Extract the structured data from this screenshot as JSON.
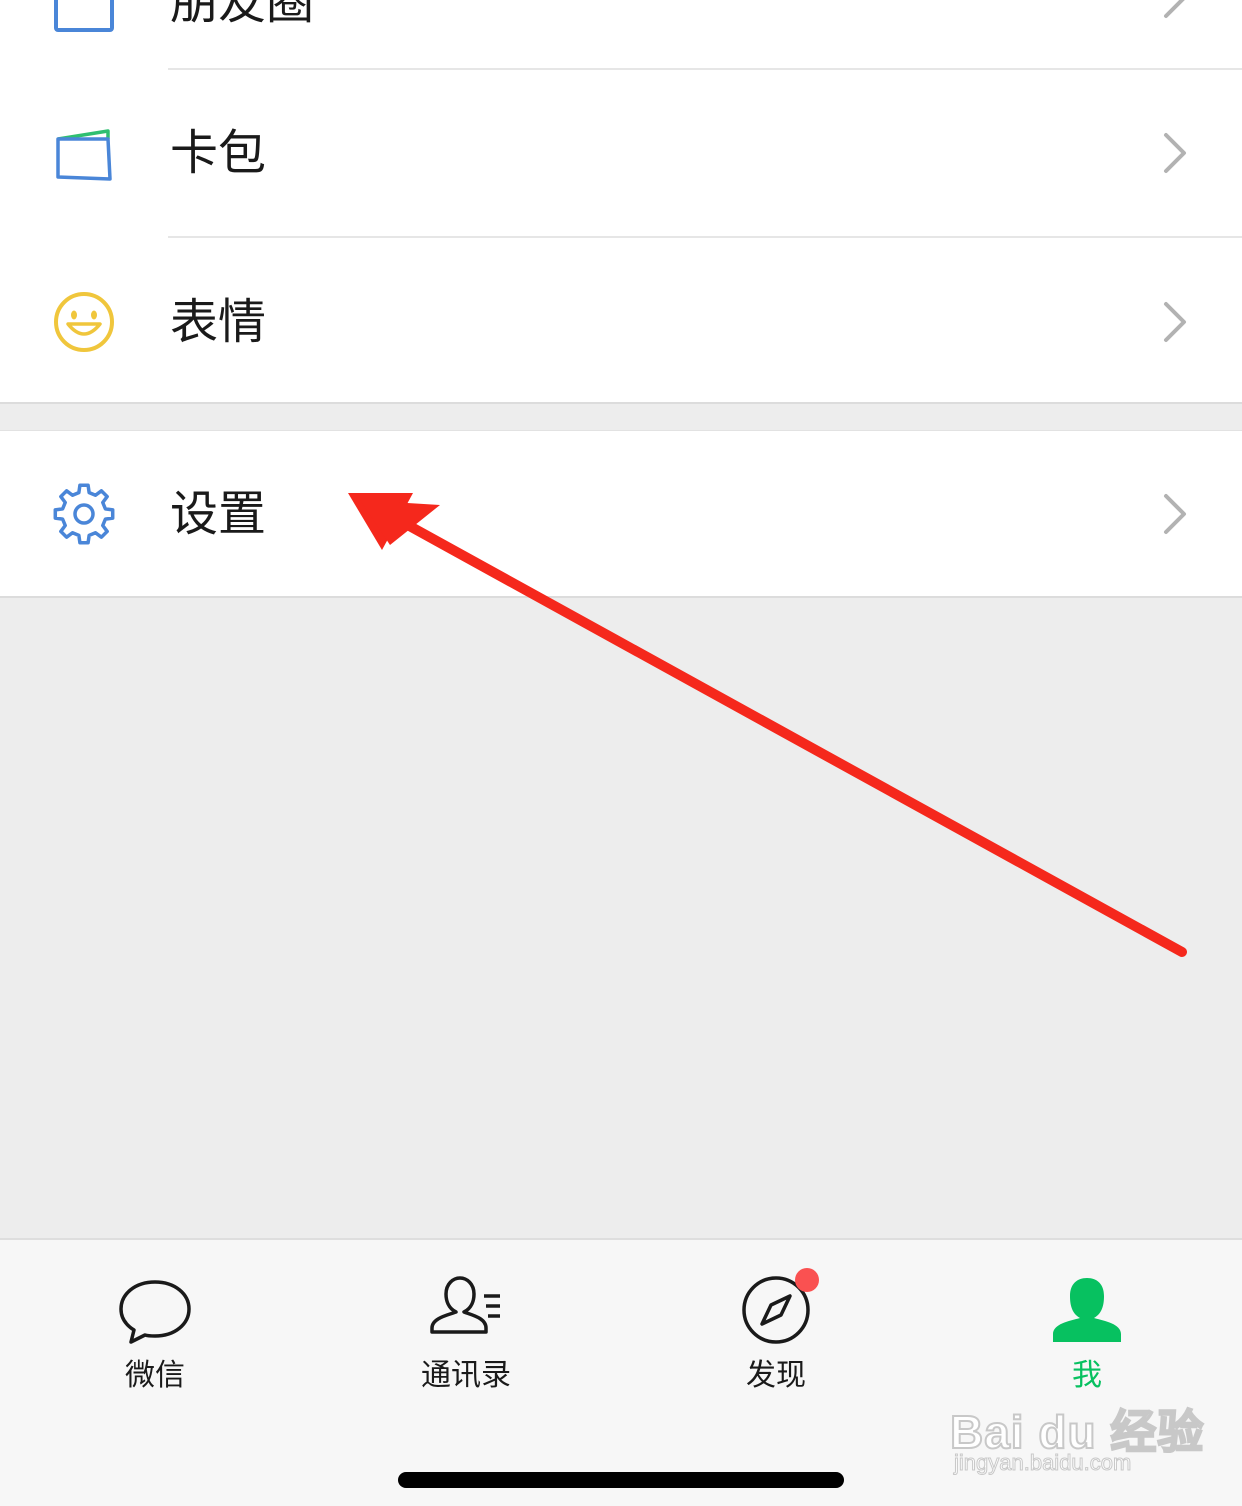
{
  "menu": {
    "partial_item_label": "朋友圈",
    "items": [
      {
        "label": "卡包",
        "icon": "card-wallet-icon"
      },
      {
        "label": "表情",
        "icon": "smiley-face-icon"
      }
    ],
    "settings": {
      "label": "设置",
      "icon": "gear-icon"
    }
  },
  "tabbar": {
    "tabs": [
      {
        "label": "微信",
        "icon": "chat-bubble-icon",
        "active": false
      },
      {
        "label": "通讯录",
        "icon": "contacts-icon",
        "active": false
      },
      {
        "label": "发现",
        "icon": "compass-icon",
        "active": false,
        "badge": true
      },
      {
        "label": "我",
        "icon": "person-icon",
        "active": true
      }
    ]
  },
  "annotation": {
    "arrow_color": "#f5281c",
    "points_to": "设置"
  },
  "watermark": {
    "brand": "Bai du 经验",
    "url": "jingyan.baidu.com"
  },
  "colors": {
    "active_green": "#07c160",
    "badge_red": "#fa5151",
    "icon_blue": "#4a86d8"
  }
}
